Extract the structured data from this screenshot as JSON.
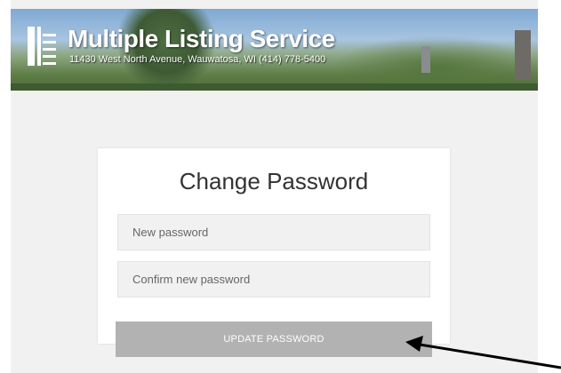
{
  "banner": {
    "title": "Multiple Listing Service",
    "address": "11430 West North Avenue, Wauwatosa, WI  (414) 778-5400",
    "logo_icon": "building-logo-icon"
  },
  "form": {
    "title": "Change Password",
    "new_password_placeholder": "New password",
    "confirm_password_placeholder": "Confirm new password",
    "submit_label": "UPDATE PASSWORD"
  },
  "annotation": {
    "icon": "pointer-arrow-icon",
    "color": "#000000"
  }
}
